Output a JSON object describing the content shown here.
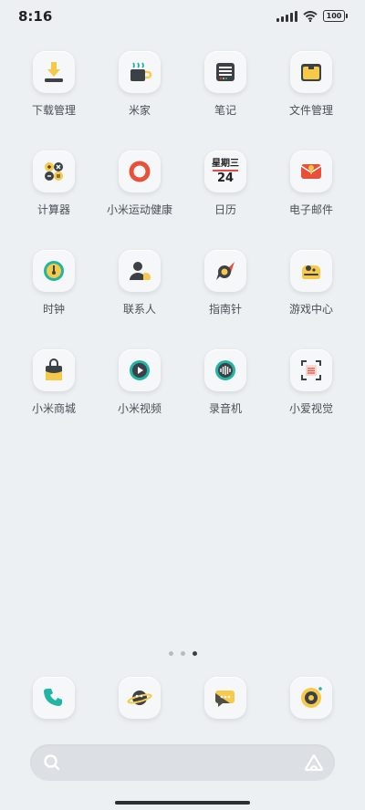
{
  "status": {
    "time": "8:16",
    "battery": "100"
  },
  "apps": [
    {
      "label": "下载管理",
      "icon": "download-icon"
    },
    {
      "label": "米家",
      "icon": "mijia-icon"
    },
    {
      "label": "笔记",
      "icon": "notes-icon"
    },
    {
      "label": "文件管理",
      "icon": "folder-icon"
    },
    {
      "label": "计算器",
      "icon": "calculator-icon"
    },
    {
      "label": "小米运动健康",
      "icon": "fitness-ring-icon"
    },
    {
      "label": "日历",
      "icon": "calendar-icon",
      "calendar_weekday": "星期三",
      "calendar_day": "24"
    },
    {
      "label": "电子邮件",
      "icon": "email-icon"
    },
    {
      "label": "时钟",
      "icon": "clock-icon"
    },
    {
      "label": "联系人",
      "icon": "contacts-icon"
    },
    {
      "label": "指南针",
      "icon": "compass-icon"
    },
    {
      "label": "游戏中心",
      "icon": "game-center-icon"
    },
    {
      "label": "小米商城",
      "icon": "shopping-bag-icon"
    },
    {
      "label": "小米视频",
      "icon": "video-play-icon"
    },
    {
      "label": "录音机",
      "icon": "recorder-icon"
    },
    {
      "label": "小爱视觉",
      "icon": "scan-icon"
    }
  ],
  "page_dots": {
    "count": 3,
    "active_index": 2
  },
  "dock": [
    {
      "icon": "phone-icon"
    },
    {
      "icon": "browser-planet-icon"
    },
    {
      "icon": "messages-icon"
    },
    {
      "icon": "camera-icon"
    }
  ],
  "colors": {
    "background": "#edf0f3",
    "accent_yellow": "#f7c948",
    "accent_teal": "#21b5a3",
    "accent_red": "#e8503a"
  }
}
